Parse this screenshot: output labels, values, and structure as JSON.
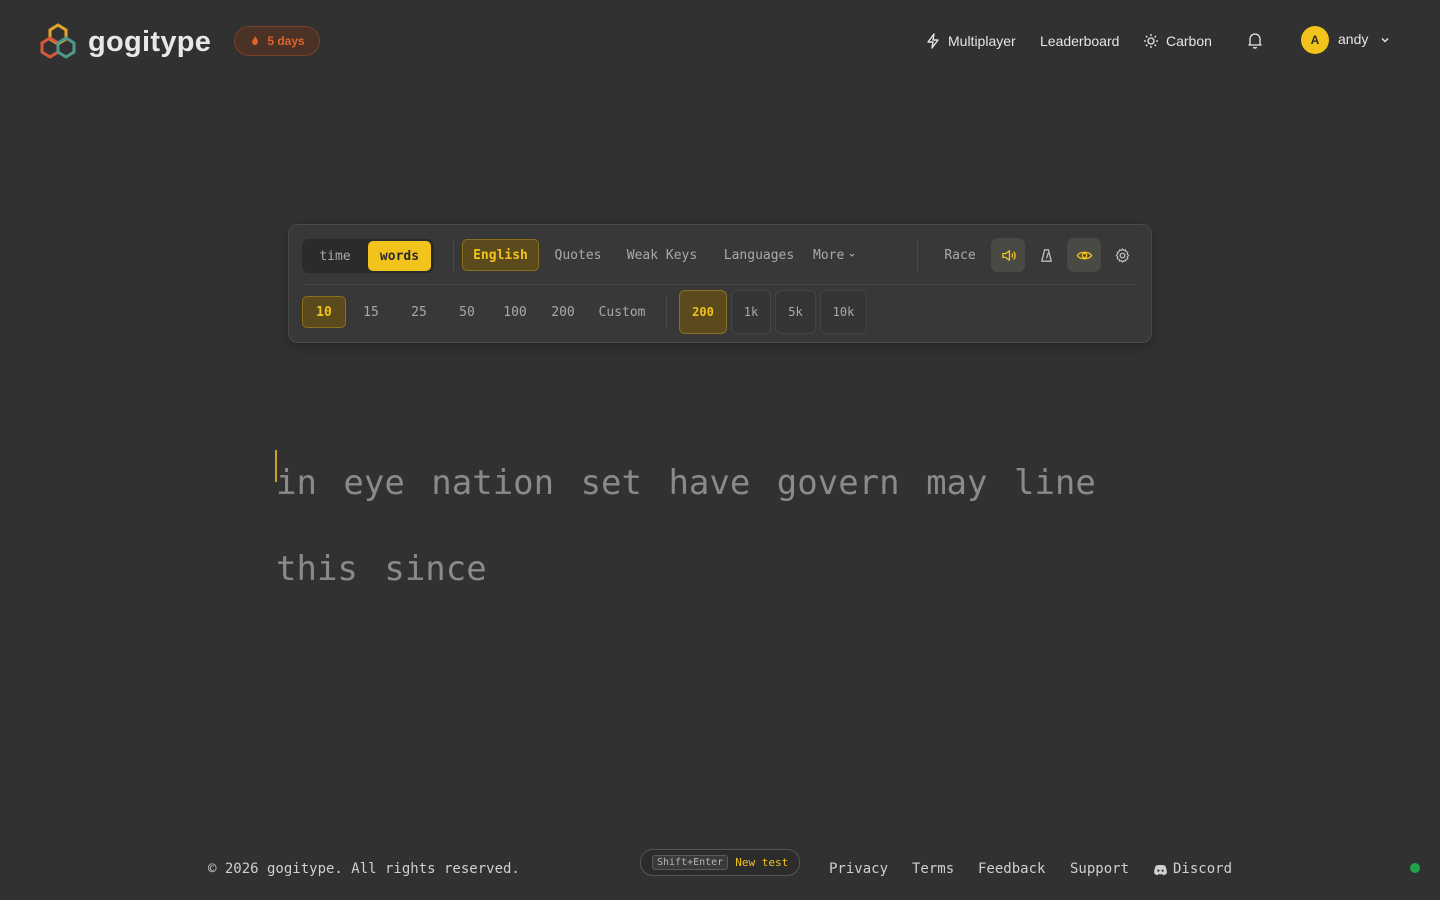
{
  "brand": {
    "name": "gogitype",
    "streak": "5 days"
  },
  "nav": {
    "multiplayer": "Multiplayer",
    "leaderboard": "Leaderboard",
    "theme": "Carbon"
  },
  "user": {
    "initial": "A",
    "name": "andy"
  },
  "config": {
    "modes": {
      "time": "time",
      "words": "words",
      "selected": "words"
    },
    "sources": [
      "English",
      "Quotes",
      "Weak Keys",
      "Languages",
      "More"
    ],
    "selected_source": "English",
    "race": "Race",
    "word_counts": [
      "10",
      "15",
      "25",
      "50",
      "100",
      "200",
      "Custom"
    ],
    "selected_word_count": "10",
    "list_sizes": [
      "200",
      "1k",
      "5k",
      "10k"
    ],
    "selected_list_size": "200",
    "icons": [
      "sound-icon",
      "metronome-icon",
      "eye-icon",
      "settings-icon"
    ]
  },
  "test": {
    "line1": "in eye nation set have govern may line",
    "line2": "this since"
  },
  "footer": {
    "copyright": "© 2026 gogitype. All rights reserved.",
    "shortcut_key": "Shift+Enter",
    "shortcut_action": "New test",
    "links": [
      "Privacy",
      "Terms",
      "Feedback",
      "Support",
      "Discord"
    ]
  },
  "colors": {
    "accent": "#f2c31a",
    "background": "#313131",
    "streak": "#e0642c",
    "status": "#1fa34a"
  }
}
